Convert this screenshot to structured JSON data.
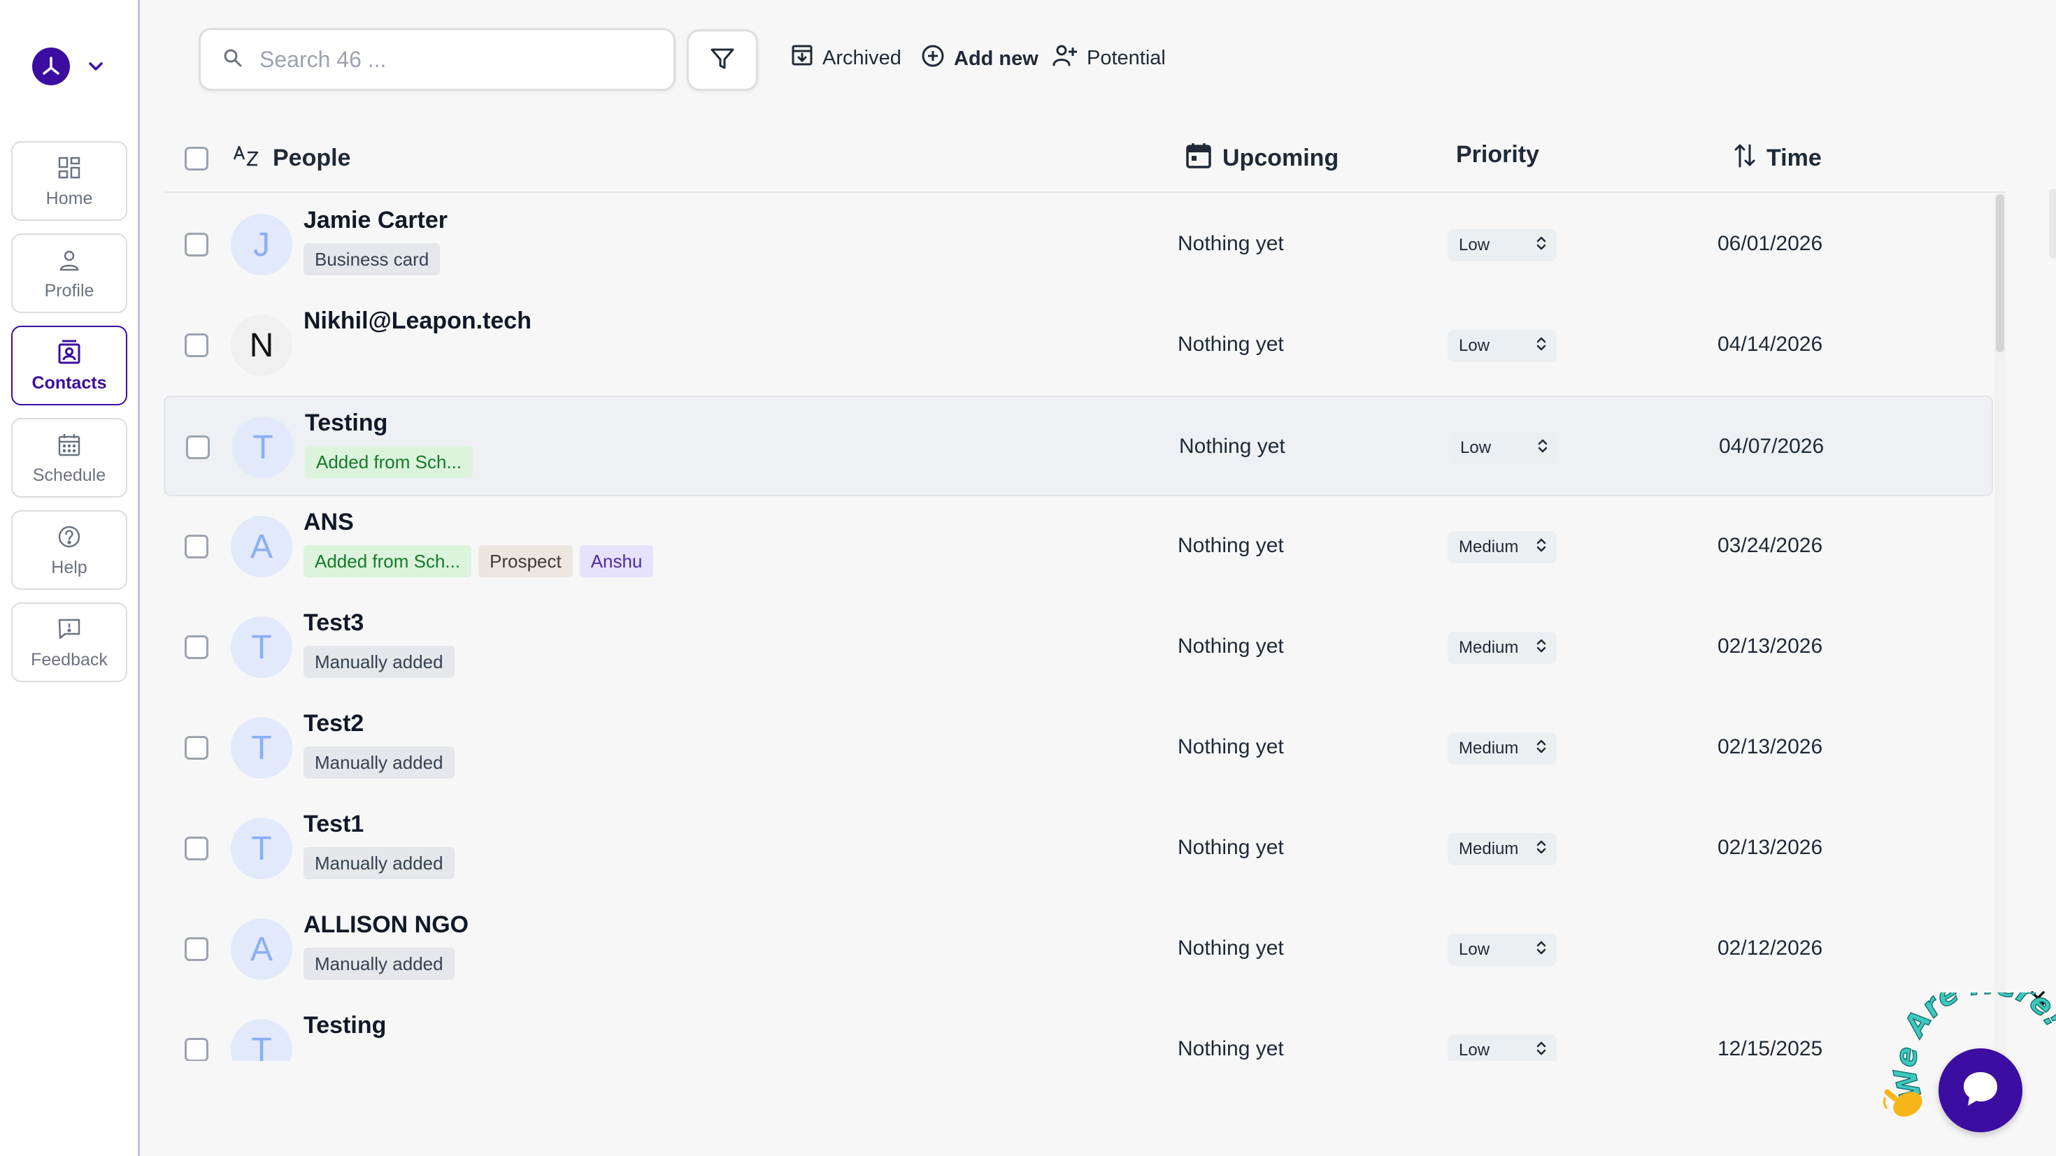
{
  "sidebar": {
    "items": [
      {
        "label": "Home",
        "icon": "dashboard-icon",
        "active": false
      },
      {
        "label": "Profile",
        "icon": "person-icon",
        "active": false
      },
      {
        "label": "Contacts",
        "icon": "contacts-icon",
        "active": true
      },
      {
        "label": "Schedule",
        "icon": "calendar-icon",
        "active": false
      },
      {
        "label": "Help",
        "icon": "help-icon",
        "active": false
      },
      {
        "label": "Feedback",
        "icon": "feedback-icon",
        "active": false
      }
    ]
  },
  "toolbar": {
    "search_placeholder": "Search 46 ...",
    "archived_label": "Archived",
    "add_new_label": "Add new",
    "potential_label": "Potential"
  },
  "table": {
    "headers": {
      "people": "People",
      "upcoming": "Upcoming",
      "priority": "Priority",
      "time": "Time"
    },
    "rows": [
      {
        "initial": "J",
        "name": "Jamie Carter",
        "tags": [
          {
            "text": "Business card",
            "style": "grey"
          }
        ],
        "upcoming": "Nothing yet",
        "priority": "Low",
        "time": "06/01/2026"
      },
      {
        "initial": "N",
        "name": "Nikhil@Leapon.tech",
        "tags": [],
        "upcoming": "Nothing yet",
        "priority": "Low",
        "time": "04/14/2026"
      },
      {
        "initial": "T",
        "name": "Testing",
        "tags": [
          {
            "text": "Added from Sch...",
            "style": "green"
          }
        ],
        "upcoming": "Nothing yet",
        "priority": "Low",
        "time": "04/07/2026"
      },
      {
        "initial": "A",
        "name": "ANS",
        "tags": [
          {
            "text": "Added from Sch...",
            "style": "green"
          },
          {
            "text": "Prospect",
            "style": "beige"
          },
          {
            "text": "Anshu",
            "style": "purple"
          }
        ],
        "upcoming": "Nothing yet",
        "priority": "Medium",
        "time": "03/24/2026"
      },
      {
        "initial": "T",
        "name": "Test3",
        "tags": [
          {
            "text": "Manually added",
            "style": "grey"
          }
        ],
        "upcoming": "Nothing yet",
        "priority": "Medium",
        "time": "02/13/2026"
      },
      {
        "initial": "T",
        "name": "Test2",
        "tags": [
          {
            "text": "Manually added",
            "style": "grey"
          }
        ],
        "upcoming": "Nothing yet",
        "priority": "Medium",
        "time": "02/13/2026"
      },
      {
        "initial": "T",
        "name": "Test1",
        "tags": [
          {
            "text": "Manually added",
            "style": "grey"
          }
        ],
        "upcoming": "Nothing yet",
        "priority": "Medium",
        "time": "02/13/2026"
      },
      {
        "initial": "A",
        "name": "ALLISON NGO",
        "tags": [
          {
            "text": "Manually added",
            "style": "grey"
          }
        ],
        "upcoming": "Nothing yet",
        "priority": "Low",
        "time": "02/12/2026"
      },
      {
        "initial": "T",
        "name": "Testing",
        "tags": [],
        "upcoming": "Nothing yet",
        "priority": "Low",
        "time": "12/15/2025"
      }
    ]
  },
  "chat": {
    "badge_text": "We Are Here!",
    "accent": "#3b0ea1"
  },
  "colors": {
    "brand": "#3b0ea1",
    "avatar_bg": "#e2e9fb",
    "avatar_fg": "#8aaef5"
  }
}
